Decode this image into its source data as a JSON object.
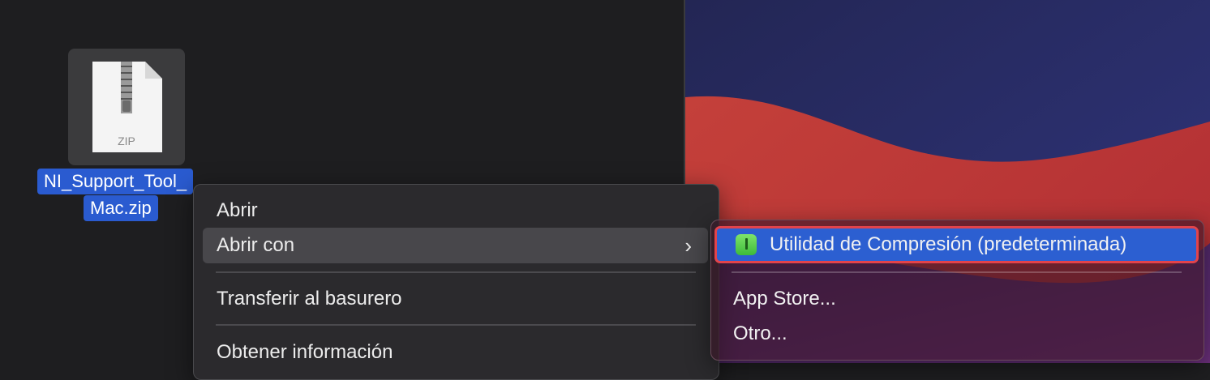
{
  "file": {
    "icon_label": "ZIP",
    "name_line1": "NI_Support_Tool_",
    "name_line2": "Mac.zip"
  },
  "context_menu": {
    "items": [
      {
        "label": "Abrir"
      },
      {
        "label": "Abrir con",
        "has_submenu": true,
        "highlighted": true
      },
      {
        "label": "Transferir al basurero"
      },
      {
        "label": "Obtener información"
      }
    ]
  },
  "submenu": {
    "default_app": {
      "label": "Utilidad de Compresión (predeterminada)",
      "icon": "archive-utility-icon",
      "selected": true
    },
    "items": [
      {
        "label": "App Store..."
      },
      {
        "label": "Otro..."
      }
    ]
  },
  "colors": {
    "selection": "#2c5fd1",
    "highlight_outline": "#e2434b",
    "menu_background": "#2b2a2d",
    "desktop_red": "#c63c38",
    "desktop_navy": "#2a2e6e"
  },
  "icons": [
    "zip-file-icon",
    "chevron-right-icon",
    "archive-utility-icon"
  ]
}
